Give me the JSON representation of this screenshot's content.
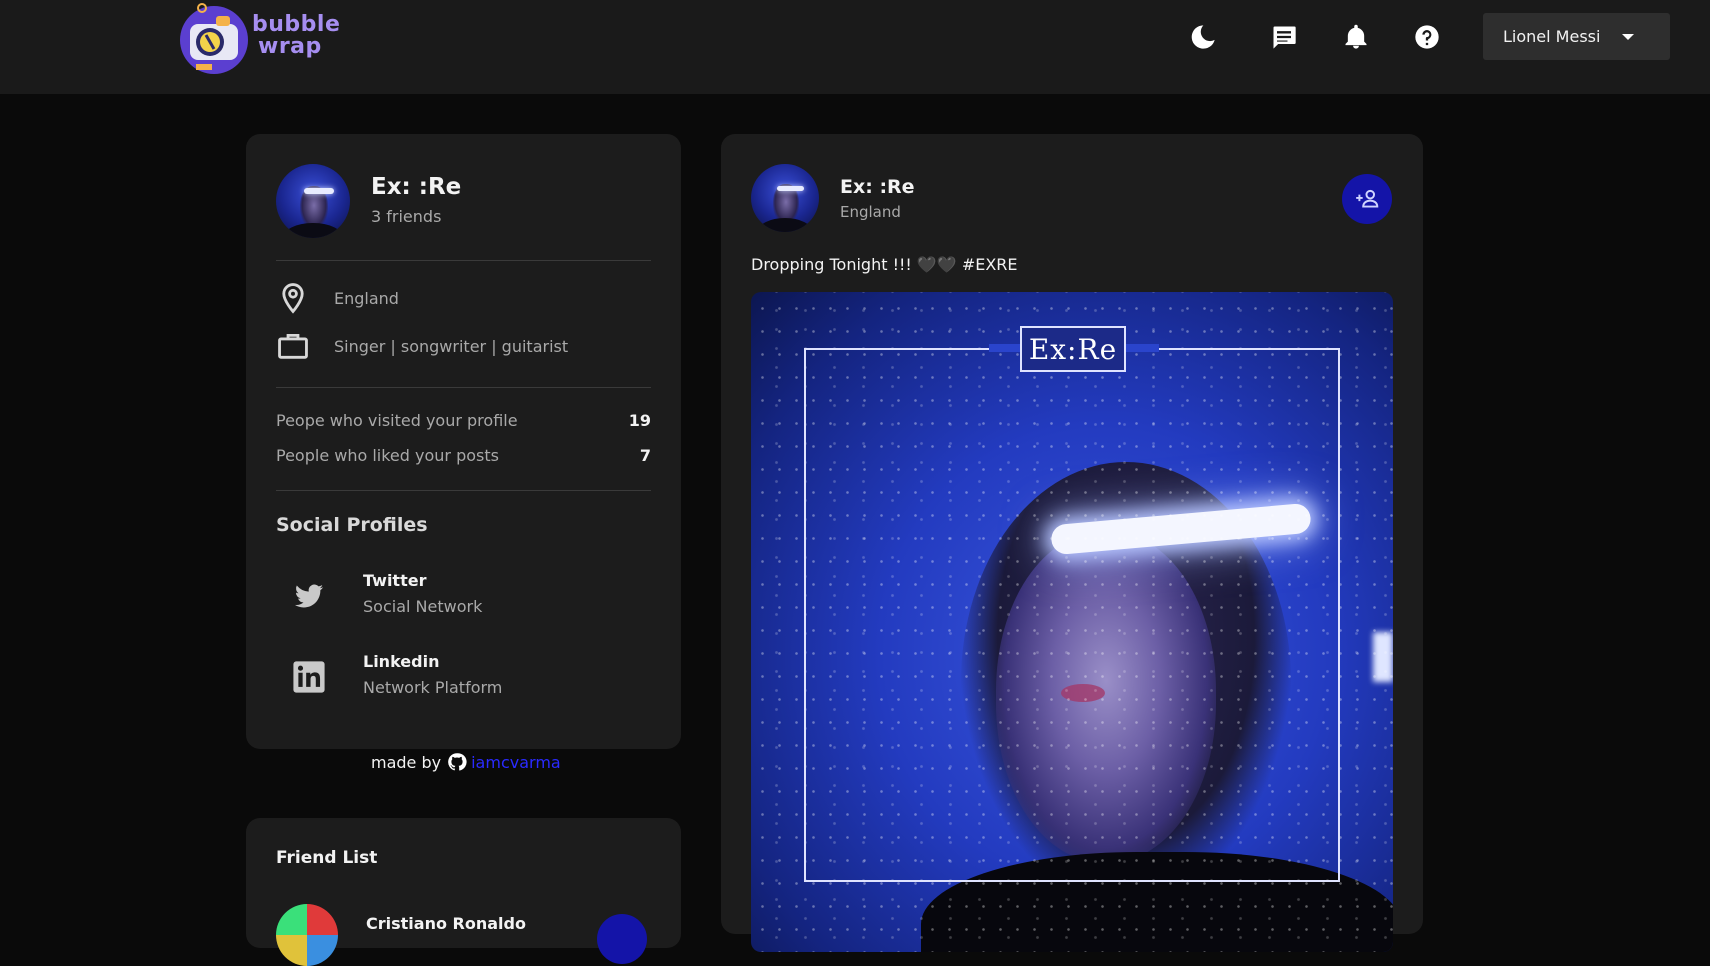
{
  "app": {
    "logo_text_line1": "bubble",
    "logo_text_line2": "wrap",
    "colors": {
      "background": "#0a0a0a",
      "navbar": "#1a1a1a",
      "card": "#1c1c1c",
      "accent": "#1414a8",
      "link": "#2a2aff",
      "logo": "#a68ef0"
    }
  },
  "navbar": {
    "icons": [
      "moon-icon",
      "chat-icon",
      "bell-icon",
      "help-icon"
    ],
    "user": {
      "name": "Lionel Messi"
    }
  },
  "profile": {
    "name": "Ex: :Re",
    "friends": "3 friends",
    "location": "England",
    "occupation": "Singer | songwriter | guitarist",
    "stats": [
      {
        "label": "Peope who visited your profile",
        "value": "19"
      },
      {
        "label": "People who liked your posts",
        "value": "7"
      }
    ],
    "social_title": "Social Profiles",
    "socials": [
      {
        "name": "Twitter",
        "sub": "Social Network",
        "icon": "twitter-icon"
      },
      {
        "name": "Linkedin",
        "sub": "Network Platform",
        "icon": "linkedin-icon"
      }
    ]
  },
  "footer": {
    "made_by": "made by",
    "author": "iamcvarma"
  },
  "post": {
    "name": "Ex: :Re",
    "location": "England",
    "text": "Dropping Tonight !!! 🖤🖤 #EXRE",
    "image_title": "Ex:Re"
  },
  "friend_list": {
    "title": "Friend List",
    "items": [
      {
        "name": "Cristiano Ronaldo"
      }
    ]
  }
}
